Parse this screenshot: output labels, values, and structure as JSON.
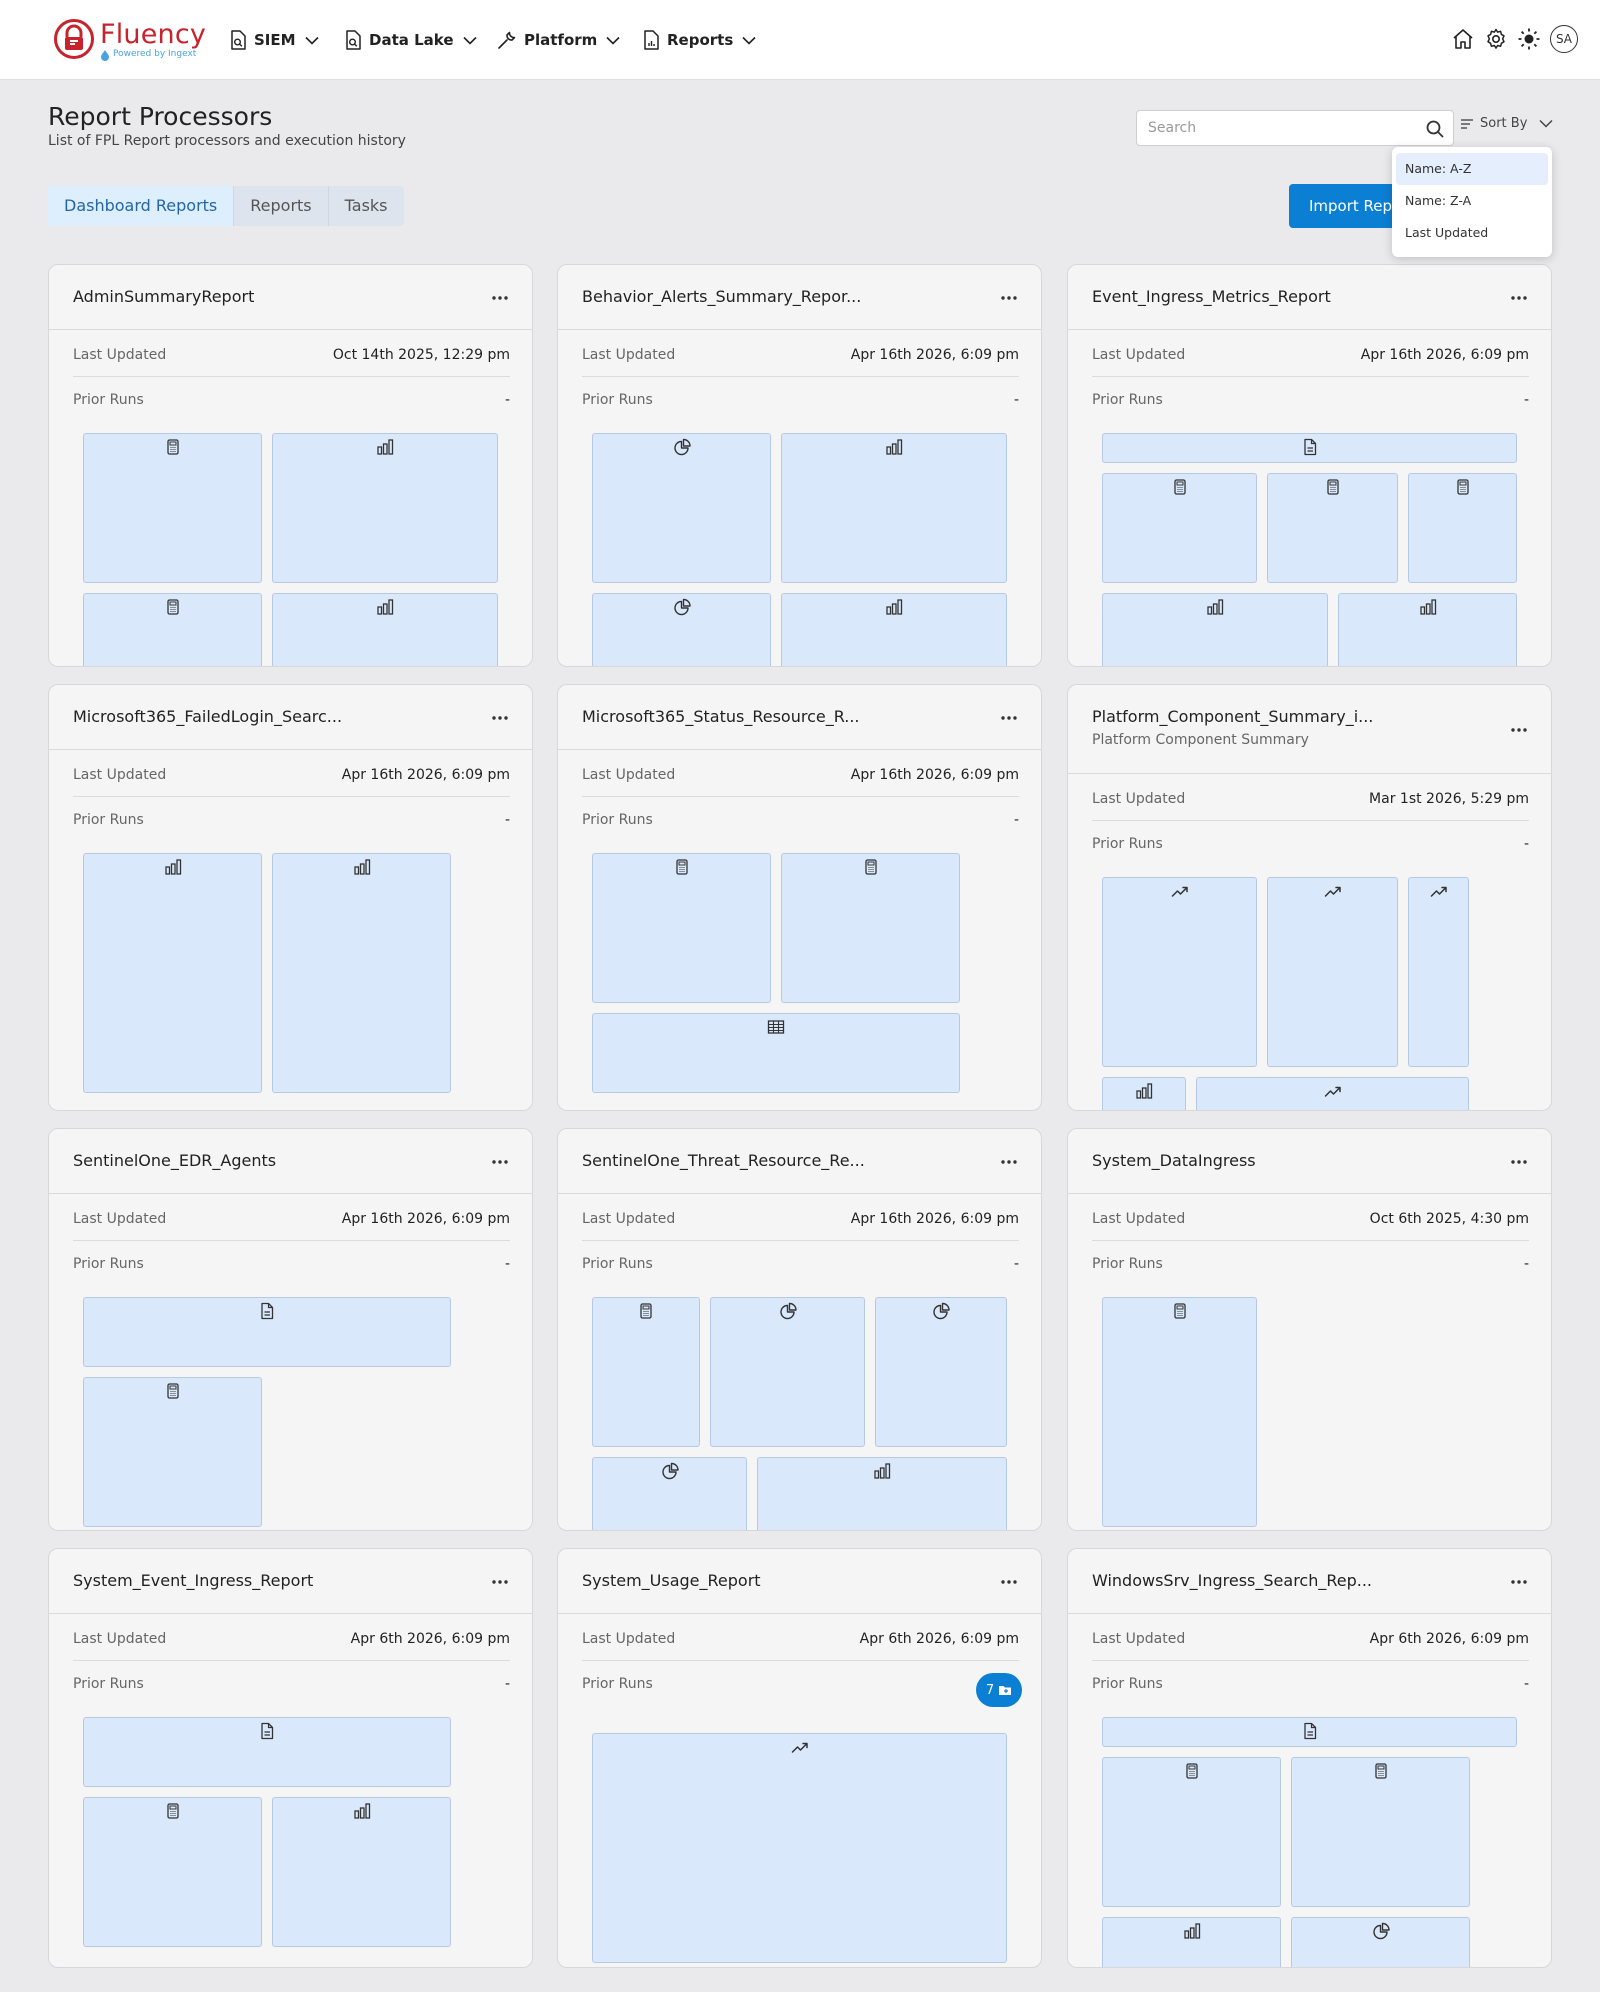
{
  "header": {
    "logo_text": "Fluency",
    "logo_sub": "Powered by Ingext",
    "nav": [
      {
        "label": "SIEM",
        "icon": "doc-search-icon"
      },
      {
        "label": "Data Lake",
        "icon": "doc-search-icon"
      },
      {
        "label": "Platform",
        "icon": "wrench-icon"
      },
      {
        "label": "Reports",
        "icon": "report-chart-icon"
      }
    ],
    "icons": [
      "home-icon",
      "gear-icon",
      "sun-icon"
    ],
    "avatar": "SA"
  },
  "page": {
    "title": "Report Processors",
    "subtitle": "List of FPL Report processors and execution history"
  },
  "search": {
    "placeholder": "Search",
    "value": ""
  },
  "sort": {
    "label": "Sort By",
    "options": [
      "Name: A-Z",
      "Name: Z-A",
      "Last Updated"
    ],
    "selected": "Name: A-Z"
  },
  "tabs": [
    {
      "label": "Dashboard Reports",
      "active": true
    },
    {
      "label": "Reports",
      "active": false
    },
    {
      "label": "Tasks",
      "active": false
    }
  ],
  "import_button": "Import Report",
  "labels": {
    "last_updated": "Last Updated",
    "prior_runs": "Prior Runs"
  },
  "cards": [
    {
      "title": "AdminSummaryReport",
      "description": "",
      "last_updated": "Oct 14th 2025, 12:29 pm",
      "prior_runs": "-",
      "tiles": [
        "calculator-icon",
        "bar-chart-icon",
        "calculator-icon",
        "bar-chart-icon"
      ]
    },
    {
      "title": "Behavior_Alerts_Summary_Repor...",
      "description": "",
      "last_updated": "Apr 16th 2026, 6:09 pm",
      "prior_runs": "-",
      "tiles": [
        "pie-chart-icon",
        "bar-chart-icon",
        "pie-chart-icon",
        "bar-chart-icon"
      ]
    },
    {
      "title": "Event_Ingress_Metrics_Report",
      "description": "",
      "last_updated": "Apr 16th 2026, 6:09 pm",
      "prior_runs": "-",
      "tiles": [
        "document-icon",
        "calculator-icon",
        "calculator-icon",
        "calculator-icon",
        "bar-chart-icon",
        "bar-chart-icon"
      ]
    },
    {
      "title": "Microsoft365_FailedLogin_Searc...",
      "description": "",
      "last_updated": "Apr 16th 2026, 6:09 pm",
      "prior_runs": "-",
      "tiles": [
        "bar-chart-icon",
        "bar-chart-icon"
      ]
    },
    {
      "title": "Microsoft365_Status_Resource_R...",
      "description": "",
      "last_updated": "Apr 16th 2026, 6:09 pm",
      "prior_runs": "-",
      "tiles": [
        "calculator-icon",
        "calculator-icon",
        "table-icon"
      ]
    },
    {
      "title": "Platform_Component_Summary_i...",
      "description": "Platform Component Summary",
      "last_updated": "Mar 1st 2026, 5:29 pm",
      "prior_runs": "-",
      "tiles": [
        "trend-icon",
        "trend-icon",
        "trend-icon",
        "bar-chart-icon",
        "trend-icon"
      ]
    },
    {
      "title": "SentinelOne_EDR_Agents",
      "description": "",
      "last_updated": "Apr 16th 2026, 6:09 pm",
      "prior_runs": "-",
      "tiles": [
        "document-icon",
        "calculator-icon"
      ]
    },
    {
      "title": "SentinelOne_Threat_Resource_Re...",
      "description": "",
      "last_updated": "Apr 16th 2026, 6:09 pm",
      "prior_runs": "-",
      "tiles": [
        "calculator-icon",
        "pie-chart-icon",
        "pie-chart-icon",
        "pie-chart-icon",
        "bar-chart-icon"
      ]
    },
    {
      "title": "System_DataIngress",
      "description": "",
      "last_updated": "Oct 6th 2025, 4:30 pm",
      "prior_runs": "-",
      "tiles": [
        "calculator-icon"
      ]
    },
    {
      "title": "System_Event_Ingress_Report",
      "description": "",
      "last_updated": "Apr 6th 2026, 6:09 pm",
      "prior_runs": "-",
      "tiles": [
        "document-icon",
        "calculator-icon",
        "bar-chart-icon"
      ]
    },
    {
      "title": "System_Usage_Report",
      "description": "",
      "last_updated": "Apr 6th 2026, 6:09 pm",
      "prior_runs": "7",
      "tiles": [
        "trend-icon"
      ]
    },
    {
      "title": "WindowsSrv_Ingress_Search_Rep...",
      "description": "",
      "last_updated": "Apr 6th 2026, 6:09 pm",
      "prior_runs": "-",
      "tiles": [
        "document-icon",
        "calculator-icon",
        "calculator-icon",
        "bar-chart-icon",
        "pie-chart-icon"
      ]
    }
  ]
}
